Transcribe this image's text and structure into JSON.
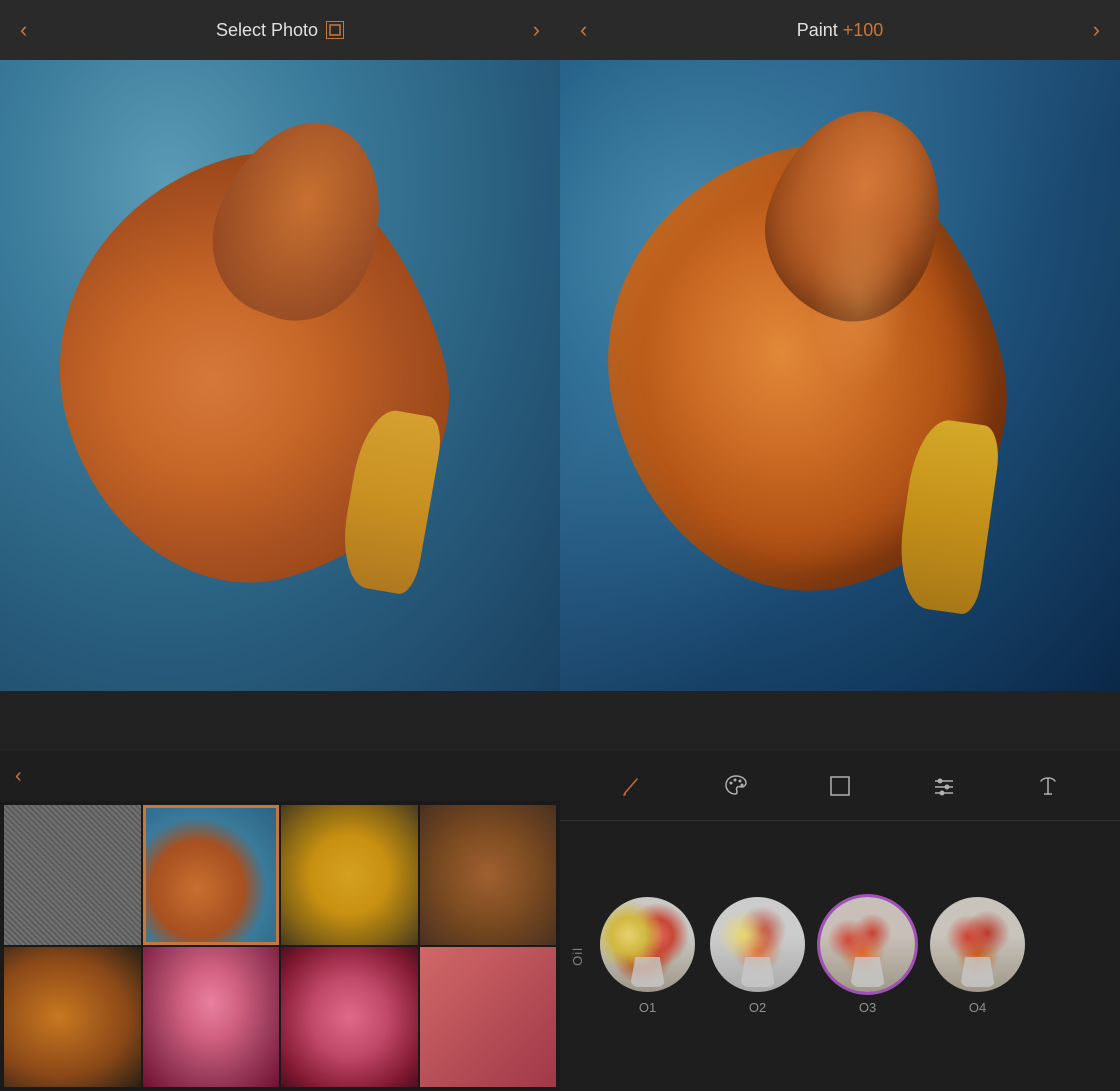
{
  "left": {
    "header": {
      "title": "Select Photo",
      "badge": "0",
      "prev_label": "‹",
      "next_label": "›"
    },
    "thumbnails": [
      {
        "id": "thumb-sticks",
        "label": "sticks",
        "selected": false
      },
      {
        "id": "thumb-flower-selected",
        "label": "wilted flower",
        "selected": true
      },
      {
        "id": "thumb-yellow-leaf",
        "label": "yellow leaf",
        "selected": false
      },
      {
        "id": "thumb-brown-leaves",
        "label": "brown leaves",
        "selected": false
      },
      {
        "id": "thumb-orange2",
        "label": "orange 2",
        "selected": false
      },
      {
        "id": "thumb-pink",
        "label": "pink flower",
        "selected": false
      },
      {
        "id": "thumb-roses",
        "label": "roses",
        "selected": false
      },
      {
        "id": "thumb-empty",
        "label": "",
        "selected": false
      }
    ]
  },
  "right": {
    "header": {
      "title": "Paint",
      "value": "+100",
      "prev_label": "‹",
      "next_label": "›"
    },
    "tools": [
      {
        "id": "brush",
        "label": "Brush"
      },
      {
        "id": "palette",
        "label": "Palette"
      },
      {
        "id": "crop",
        "label": "Crop"
      },
      {
        "id": "adjust",
        "label": "Adjust"
      },
      {
        "id": "text",
        "label": "Text"
      }
    ],
    "filter_section_label": "Oil",
    "filters": [
      {
        "id": "O1",
        "label": "O1",
        "active": false
      },
      {
        "id": "O2",
        "label": "O2",
        "active": false
      },
      {
        "id": "O3",
        "label": "O3",
        "active": true
      },
      {
        "id": "O4",
        "label": "O4",
        "active": false
      }
    ]
  },
  "colors": {
    "accent": "#c8773a",
    "active_filter_ring": "#a050b8",
    "header_bg": "#2a2a2a",
    "panel_bg": "#1a1a1a",
    "tools_bg": "#1e1e1e",
    "text_primary": "#e0e0e0",
    "text_secondary": "#909090"
  }
}
